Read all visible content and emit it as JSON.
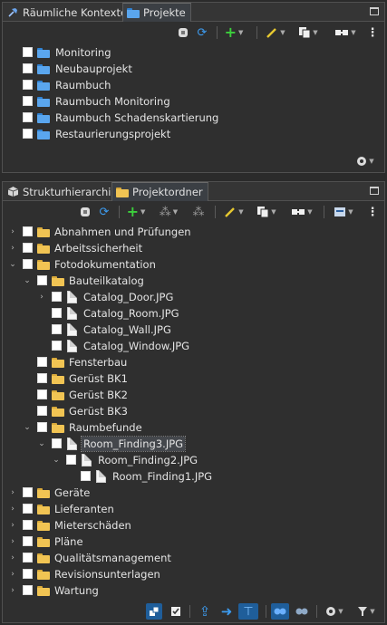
{
  "top_panel": {
    "tabs": [
      {
        "label": "Räumliche Kontexte",
        "icon": "pin-icon"
      },
      {
        "label": "Projekte",
        "icon": "folder-icon"
      }
    ],
    "toolbar": [
      "filter-icon",
      "refresh-icon",
      "add-icon",
      "edit-icon",
      "copy-icon",
      "link-icon",
      "more-icon"
    ],
    "items": [
      "Monitoring",
      "Neubauprojekt",
      "Raumbuch",
      "Raumbuch Monitoring",
      "Raumbuch Schadenskartierung",
      "Restaurierungsprojekt"
    ],
    "bottom_icon": "settings-icon"
  },
  "bottom_panel": {
    "tabs": [
      {
        "label": "Strukturhierarchie",
        "icon": "cube-icon"
      },
      {
        "label": "Projektordner",
        "icon": "folder-icon"
      }
    ],
    "tree": [
      {
        "label": "Abnahmen und Prüfungen",
        "level": 0,
        "type": "folder",
        "expand": "closed"
      },
      {
        "label": "Arbeitssicherheit",
        "level": 0,
        "type": "folder",
        "expand": "closed"
      },
      {
        "label": "Fotodokumentation",
        "level": 0,
        "type": "folder",
        "expand": "open"
      },
      {
        "label": "Bauteilkatalog",
        "level": 1,
        "type": "folder",
        "expand": "open"
      },
      {
        "label": "Catalog_Door.JPG",
        "level": 2,
        "type": "file",
        "expand": "closed"
      },
      {
        "label": "Catalog_Room.JPG",
        "level": 2,
        "type": "file",
        "expand": "none"
      },
      {
        "label": "Catalog_Wall.JPG",
        "level": 2,
        "type": "file",
        "expand": "none"
      },
      {
        "label": "Catalog_Window.JPG",
        "level": 2,
        "type": "file",
        "expand": "none"
      },
      {
        "label": "Fensterbau",
        "level": 1,
        "type": "folder",
        "expand": "none"
      },
      {
        "label": "Gerüst BK1",
        "level": 1,
        "type": "folder",
        "expand": "none"
      },
      {
        "label": "Gerüst BK2",
        "level": 1,
        "type": "folder",
        "expand": "none"
      },
      {
        "label": "Gerüst BK3",
        "level": 1,
        "type": "folder",
        "expand": "none"
      },
      {
        "label": "Raumbefunde",
        "level": 1,
        "type": "folder",
        "expand": "open"
      },
      {
        "label": "Room_Finding3.JPG",
        "level": 2,
        "type": "file",
        "expand": "open",
        "selected": true
      },
      {
        "label": "Room_Finding2.JPG",
        "level": 3,
        "type": "file",
        "expand": "open"
      },
      {
        "label": "Room_Finding1.JPG",
        "level": 4,
        "type": "file",
        "expand": "none"
      },
      {
        "label": "Geräte",
        "level": 0,
        "type": "folder",
        "expand": "closed"
      },
      {
        "label": "Lieferanten",
        "level": 0,
        "type": "folder",
        "expand": "closed"
      },
      {
        "label": "Mieterschäden",
        "level": 0,
        "type": "folder",
        "expand": "closed"
      },
      {
        "label": "Pläne",
        "level": 0,
        "type": "folder",
        "expand": "closed"
      },
      {
        "label": "Qualitätsmanagement",
        "level": 0,
        "type": "folder",
        "expand": "closed"
      },
      {
        "label": "Revisionsunterlagen",
        "level": 0,
        "type": "folder",
        "expand": "closed"
      },
      {
        "label": "Wartung",
        "level": 0,
        "type": "folder",
        "expand": "closed"
      }
    ]
  },
  "colors": {
    "accent_blue": "#2f82d4",
    "folder_yellow": "#f1c453",
    "add_green": "#3ccf3c",
    "edit_yellow": "#e6c830"
  }
}
